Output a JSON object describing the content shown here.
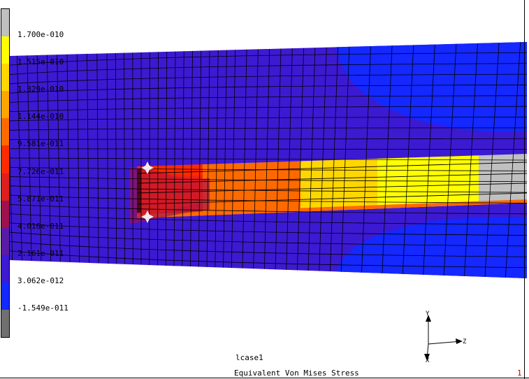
{
  "legend": {
    "labels": [
      "1.700e-010",
      "1.515e-010",
      "1.329e-010",
      "1.144e-010",
      "9.581e-011",
      "7.726e-011",
      "5.871e-011",
      "4.016e-011",
      "2.161e-011",
      "3.062e-012",
      "-1.549e-011"
    ],
    "colors": [
      "#c0c0c0",
      "#ffff00",
      "#ffd700",
      "#ffa500",
      "#ff6a00",
      "#ff2a00",
      "#e01e1e",
      "#a01050",
      "#5a1aa8",
      "#3c1ad2",
      "#1428ff",
      "#707070"
    ]
  },
  "model": {
    "background_color": "#3c1ad2",
    "mesh_color": "#000000"
  },
  "triad": {
    "axis_y": "Y",
    "axis_z": "Z",
    "axis_x": "X"
  },
  "footer": {
    "loadcase": "lcase1",
    "result_type": "Equivalent Von Mises Stress",
    "viewport_number": "1"
  }
}
